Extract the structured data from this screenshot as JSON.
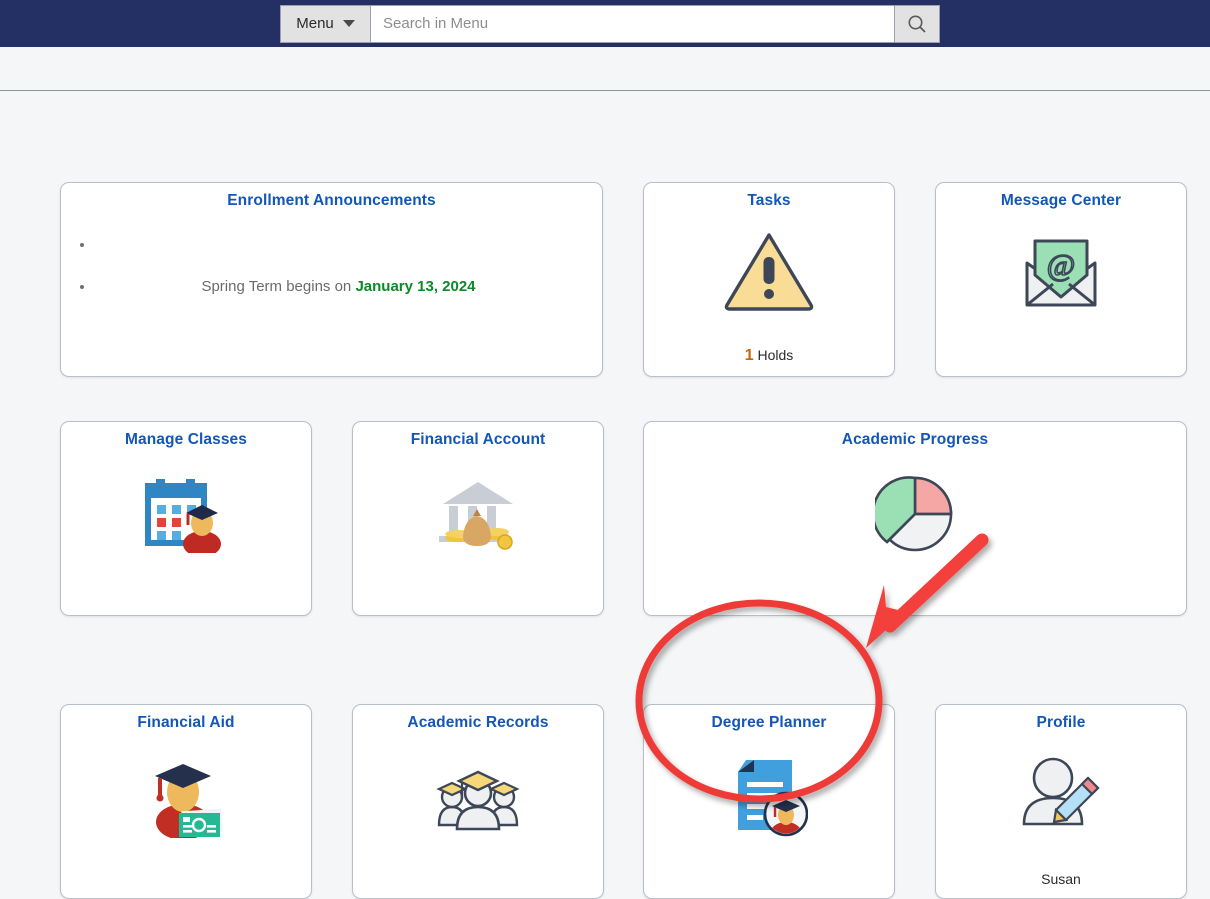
{
  "header": {
    "menu_label": "Menu",
    "search_placeholder": "Search in Menu",
    "search_value": "",
    "search_icon": "search-icon",
    "caret_icon": "chevron-down-icon",
    "bar_color": "#242f63"
  },
  "tiles": {
    "enrollment_announcements": {
      "title": "Enrollment Announcements",
      "bullets": [
        {
          "text": ""
        },
        {
          "text": "Spring Term begins on ",
          "highlight": "January 13, 2024",
          "highlight_color": "#0a8a28"
        }
      ]
    },
    "tasks": {
      "title": "Tasks",
      "icon": "warning-triangle-icon",
      "count": "1",
      "count_label": "Holds",
      "count_color": "#c1690b"
    },
    "message_center": {
      "title": "Message Center",
      "icon": "envelope-at-icon"
    },
    "manage_classes": {
      "title": "Manage Classes",
      "icon": "calendar-student-icon"
    },
    "financial_account": {
      "title": "Financial Account",
      "icon": "bank-money-icon"
    },
    "academic_progress": {
      "title": "Academic Progress",
      "icon": "pie-chart-icon"
    },
    "financial_aid": {
      "title": "Financial Aid",
      "icon": "graduate-money-icon"
    },
    "academic_records": {
      "title": "Academic Records",
      "icon": "graduates-group-icon"
    },
    "degree_planner": {
      "title": "Degree Planner",
      "icon": "document-graduate-icon",
      "highlighted": true
    },
    "profile": {
      "title": "Profile",
      "icon": "person-pencil-icon",
      "user_name": "Susan"
    }
  },
  "annotations": {
    "circle_color": "#ef3b37",
    "arrow_color": "#f4403c",
    "target": "degree_planner"
  },
  "chart_data": {
    "type": "pie",
    "title": "Academic Progress",
    "categories": [
      "Green segment",
      "Red segment",
      "White segment"
    ],
    "values": [
      42,
      25,
      33
    ],
    "colors": [
      "#9ae0b4",
      "#f4a7a4",
      "#f0f2f4"
    ],
    "legend": "none",
    "xlabel": "",
    "ylabel": ""
  }
}
